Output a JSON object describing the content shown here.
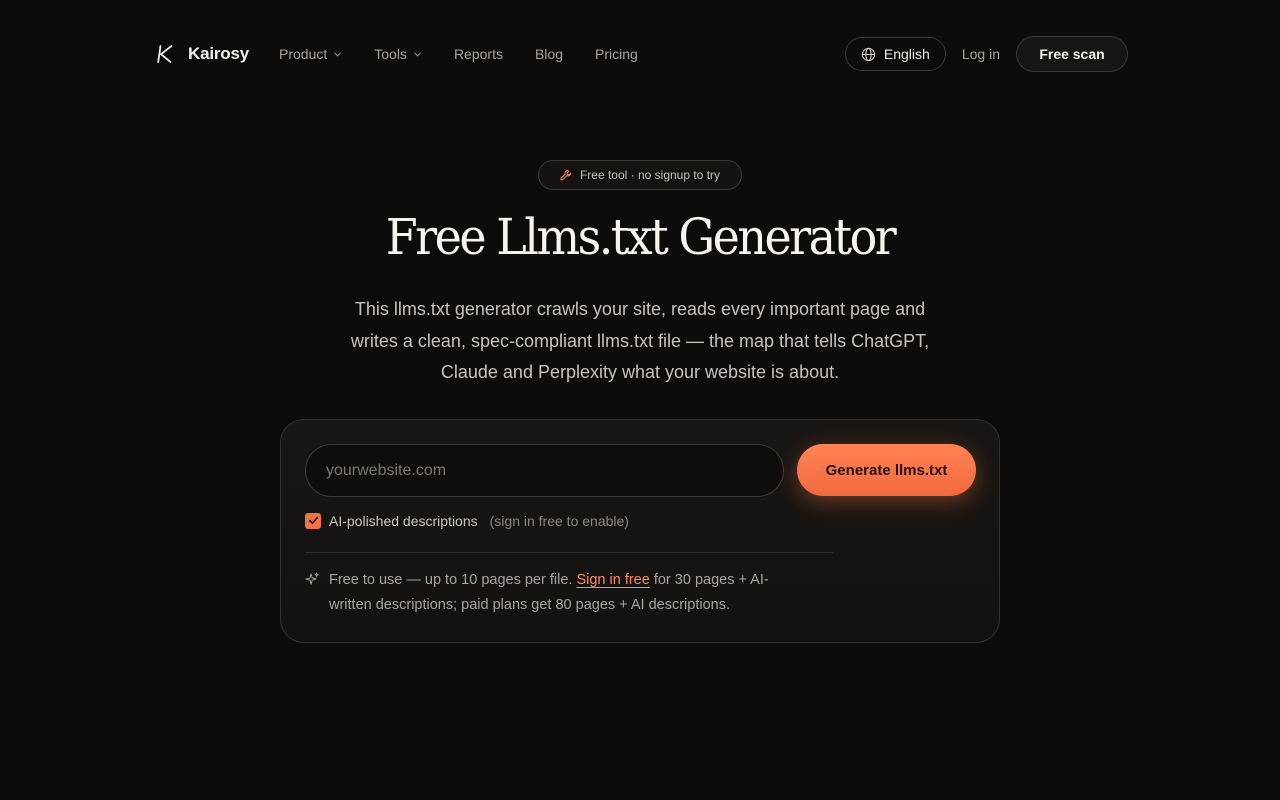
{
  "nav": {
    "logo_text": "Kairosy",
    "menu": [
      {
        "label": "Product",
        "dropdown": true
      },
      {
        "label": "Tools",
        "dropdown": true
      },
      {
        "label": "Reports",
        "dropdown": false
      },
      {
        "label": "Blog",
        "dropdown": false
      },
      {
        "label": "Pricing",
        "dropdown": false
      }
    ],
    "language": "English",
    "login": "Log in",
    "cta": "Free scan"
  },
  "hero": {
    "badge": "Free tool · no signup to try",
    "title": "Free Llms.txt Generator",
    "description": "This llms.txt generator crawls your site, reads every important page and writes a clean, spec-compliant llms.txt file — the map that tells ChatGPT, Claude and Perplexity what your website is about."
  },
  "form": {
    "url_placeholder": "yourwebsite.com",
    "url_value": "",
    "submit_label": "Generate llms.txt",
    "ai_option": {
      "checked": true,
      "label": "AI-polished descriptions",
      "hint": "(sign in free to enable)"
    },
    "note": {
      "before": "Free to use — up to 10 pages per file. ",
      "link": "Sign in free",
      "after": " for 30 pages + AI-written descriptions; paid plans get 80 pages + AI descriptions."
    }
  },
  "colors": {
    "background": "#0d0c0b",
    "accent": "#f26a3f",
    "link": "#ff8a62"
  },
  "icons": [
    "kairosy-logo-icon",
    "chevron-down-icon",
    "globe-icon",
    "wrench-icon",
    "checkmark-icon",
    "sparkle-icon"
  ]
}
